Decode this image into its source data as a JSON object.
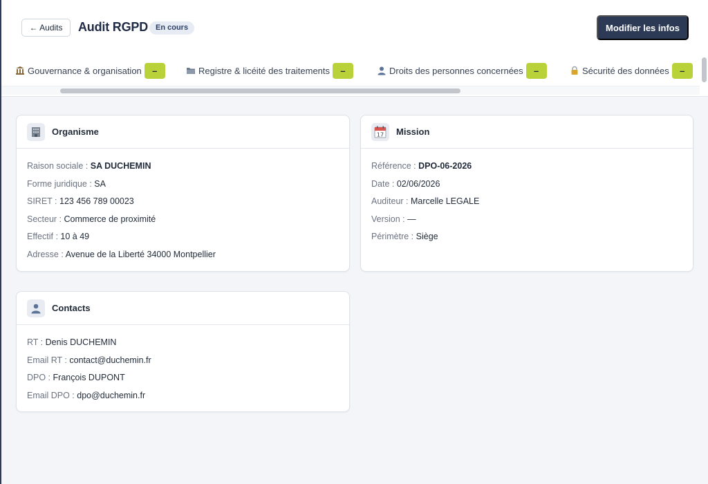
{
  "header": {
    "back_label": "← Audits",
    "title": "Audit RGPD",
    "status": "En cours",
    "edit_label": "Modifier les infos"
  },
  "tabs": [
    {
      "label": "Gouvernance & organisation",
      "icon": "building-icon",
      "badge": "–"
    },
    {
      "label": "Registre & licéité des traitements",
      "icon": "folder-icon",
      "badge": "–"
    },
    {
      "label": "Droits des personnes concernées",
      "icon": "person-icon",
      "badge": "–"
    },
    {
      "label": "Sécurité des données",
      "icon": "lock-icon",
      "badge": "–"
    }
  ],
  "organisme": {
    "title": "Organisme",
    "icon": "office-building-icon",
    "rows": [
      {
        "label": "Raison sociale :",
        "value": "SA DUCHEMIN",
        "bold": true
      },
      {
        "label": "Forme juridique :",
        "value": "SA"
      },
      {
        "label": "SIRET :",
        "value": "123 456 789 00023"
      },
      {
        "label": "Secteur :",
        "value": "Commerce de proximité"
      },
      {
        "label": "Effectif :",
        "value": "10 à 49"
      },
      {
        "label": "Adresse :",
        "value": "Avenue de la Liberté 34000 Montpellier"
      }
    ]
  },
  "mission": {
    "title": "Mission",
    "icon": "calendar-icon",
    "calendar_day": "17",
    "rows": [
      {
        "label": "Référence :",
        "value": "DPO-06-2026",
        "bold": true
      },
      {
        "label": "Date :",
        "value": "02/06/2026"
      },
      {
        "label": "Auditeur :",
        "value": "Marcelle LEGALE"
      },
      {
        "label": "Version :",
        "value": "—"
      },
      {
        "label": "Périmètre :",
        "value": "Siège"
      }
    ]
  },
  "contacts": {
    "title": "Contacts",
    "icon": "person-icon",
    "rows": [
      {
        "label": "RT :",
        "value": "Denis DUCHEMIN"
      },
      {
        "label": "Email RT :",
        "value": "contact@duchemin.fr"
      },
      {
        "label": "DPO :",
        "value": "François DUPONT"
      },
      {
        "label": "Email DPO :",
        "value": "dpo@duchemin.fr"
      }
    ]
  },
  "colors": {
    "primary": "#2c3a55",
    "badge": "#b9d23a",
    "background": "#f3f5f9"
  }
}
